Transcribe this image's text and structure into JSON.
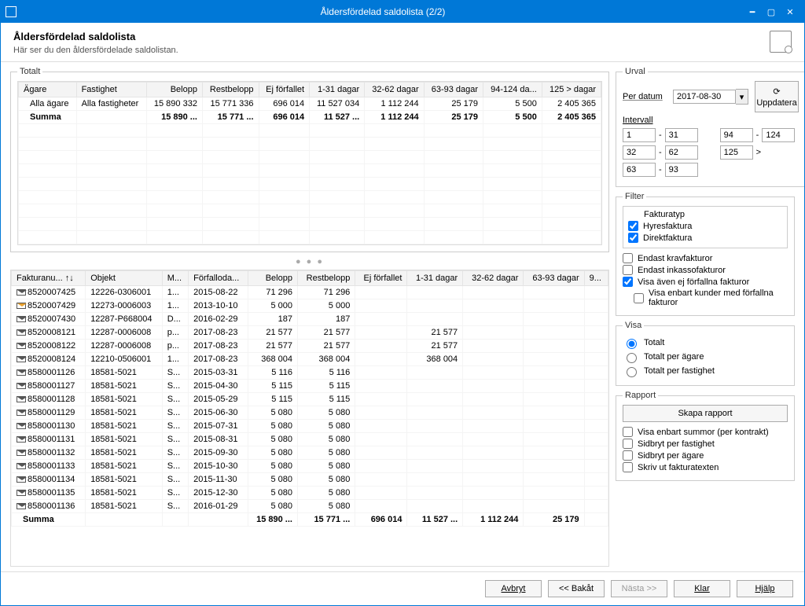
{
  "window": {
    "title": "Åldersfördelad saldolista (2/2)"
  },
  "header": {
    "title": "Åldersfördelad saldolista",
    "subtitle": "Här ser du den åldersfördelade saldolistan."
  },
  "topGrid": {
    "legend": "Totalt",
    "columns": [
      "Ägare",
      "Fastighet",
      "Belopp",
      "Restbelopp",
      "Ej förfallet",
      "1-31 dagar",
      "32-62 dagar",
      "63-93 dagar",
      "94-124 da...",
      "125 > dagar"
    ],
    "rows": [
      {
        "cells": [
          "Alla ägare",
          "Alla fastigheter",
          "15 890 332",
          "15 771 336",
          "696 014",
          "11 527 034",
          "1 112 244",
          "25 179",
          "5 500",
          "2 405 365"
        ],
        "indent": true
      },
      {
        "cells": [
          "Summa",
          "",
          "15 890 ...",
          "15 771 ...",
          "696 014",
          "11 527 ...",
          "1 112 244",
          "25 179",
          "5 500",
          "2 405 365"
        ],
        "bold": true,
        "indent": true
      }
    ]
  },
  "detailGrid": {
    "columns": [
      "Fakturanu...   ↑↓",
      "Objekt",
      "M...",
      "Förfalloda...",
      "Belopp",
      "Restbelopp",
      "Ej förfallet",
      "1-31 dagar",
      "32-62 dagar",
      "63-93 dagar",
      "9..."
    ],
    "rows": [
      {
        "fnr": "8520007425",
        "obj": "12226-0306001",
        "m": "1...",
        "fd": "2015-08-22",
        "bel": "71 296",
        "rest": "71 296",
        "ef": "",
        "d1": "",
        "d2": "",
        "d3": ""
      },
      {
        "fnr": "8520007429",
        "obj": "12273-0006003",
        "m": "1...",
        "fd": "2013-10-10",
        "bel": "5 000",
        "rest": "5 000",
        "ef": "",
        "d1": "",
        "d2": "",
        "d3": "",
        "orange": true
      },
      {
        "fnr": "8520007430",
        "obj": "12287-P668004",
        "m": "D...",
        "fd": "2016-02-29",
        "bel": "187",
        "rest": "187",
        "ef": "",
        "d1": "",
        "d2": "",
        "d3": ""
      },
      {
        "fnr": "8520008121",
        "obj": "12287-0006008",
        "m": "p...",
        "fd": "2017-08-23",
        "bel": "21 577",
        "rest": "21 577",
        "ef": "",
        "d1": "21 577",
        "d2": "",
        "d3": ""
      },
      {
        "fnr": "8520008122",
        "obj": "12287-0006008",
        "m": "p...",
        "fd": "2017-08-23",
        "bel": "21 577",
        "rest": "21 577",
        "ef": "",
        "d1": "21 577",
        "d2": "",
        "d3": ""
      },
      {
        "fnr": "8520008124",
        "obj": "12210-0506001",
        "m": "1...",
        "fd": "2017-08-23",
        "bel": "368 004",
        "rest": "368 004",
        "ef": "",
        "d1": "368 004",
        "d2": "",
        "d3": ""
      },
      {
        "fnr": "8580001126",
        "obj": "18581-5021",
        "m": "S...",
        "fd": "2015-03-31",
        "bel": "5 116",
        "rest": "5 116",
        "ef": "",
        "d1": "",
        "d2": "",
        "d3": ""
      },
      {
        "fnr": "8580001127",
        "obj": "18581-5021",
        "m": "S...",
        "fd": "2015-04-30",
        "bel": "5 115",
        "rest": "5 115",
        "ef": "",
        "d1": "",
        "d2": "",
        "d3": ""
      },
      {
        "fnr": "8580001128",
        "obj": "18581-5021",
        "m": "S...",
        "fd": "2015-05-29",
        "bel": "5 115",
        "rest": "5 115",
        "ef": "",
        "d1": "",
        "d2": "",
        "d3": ""
      },
      {
        "fnr": "8580001129",
        "obj": "18581-5021",
        "m": "S...",
        "fd": "2015-06-30",
        "bel": "5 080",
        "rest": "5 080",
        "ef": "",
        "d1": "",
        "d2": "",
        "d3": ""
      },
      {
        "fnr": "8580001130",
        "obj": "18581-5021",
        "m": "S...",
        "fd": "2015-07-31",
        "bel": "5 080",
        "rest": "5 080",
        "ef": "",
        "d1": "",
        "d2": "",
        "d3": ""
      },
      {
        "fnr": "8580001131",
        "obj": "18581-5021",
        "m": "S...",
        "fd": "2015-08-31",
        "bel": "5 080",
        "rest": "5 080",
        "ef": "",
        "d1": "",
        "d2": "",
        "d3": ""
      },
      {
        "fnr": "8580001132",
        "obj": "18581-5021",
        "m": "S...",
        "fd": "2015-09-30",
        "bel": "5 080",
        "rest": "5 080",
        "ef": "",
        "d1": "",
        "d2": "",
        "d3": ""
      },
      {
        "fnr": "8580001133",
        "obj": "18581-5021",
        "m": "S...",
        "fd": "2015-10-30",
        "bel": "5 080",
        "rest": "5 080",
        "ef": "",
        "d1": "",
        "d2": "",
        "d3": ""
      },
      {
        "fnr": "8580001134",
        "obj": "18581-5021",
        "m": "S...",
        "fd": "2015-11-30",
        "bel": "5 080",
        "rest": "5 080",
        "ef": "",
        "d1": "",
        "d2": "",
        "d3": ""
      },
      {
        "fnr": "8580001135",
        "obj": "18581-5021",
        "m": "S...",
        "fd": "2015-12-30",
        "bel": "5 080",
        "rest": "5 080",
        "ef": "",
        "d1": "",
        "d2": "",
        "d3": ""
      },
      {
        "fnr": "8580001136",
        "obj": "18581-5021",
        "m": "S...",
        "fd": "2016-01-29",
        "bel": "5 080",
        "rest": "5 080",
        "ef": "",
        "d1": "",
        "d2": "",
        "d3": ""
      }
    ],
    "sum": {
      "label": "Summa",
      "bel": "15 890 ...",
      "rest": "15 771 ...",
      "ef": "696 014",
      "d1": "11 527 ...",
      "d2": "1 112 244",
      "d3": "25 179"
    }
  },
  "urval": {
    "legend": "Urval",
    "perDatumLabel": "Per datum",
    "perDatum": "2017-08-30",
    "uppdatera": "Uppdatera",
    "intervallLabel": "Intervall",
    "r": [
      [
        "1",
        "31",
        "94",
        "124"
      ],
      [
        "32",
        "62",
        "125",
        ">"
      ],
      [
        "63",
        "93",
        "",
        ""
      ]
    ]
  },
  "filter": {
    "legend": "Filter",
    "typeHeader": "Fakturatyp",
    "types": [
      {
        "label": "Hyresfaktura",
        "checked": true
      },
      {
        "label": "Direktfaktura",
        "checked": true
      }
    ],
    "opts": [
      {
        "label": "Endast kravfakturor",
        "checked": false
      },
      {
        "label": "Endast inkassofakturor",
        "checked": false
      },
      {
        "label": "Visa även ej förfallna fakturor",
        "checked": true
      },
      {
        "label": "Visa enbart kunder med förfallna fakturor",
        "checked": false,
        "indent": true
      }
    ]
  },
  "visa": {
    "legend": "Visa",
    "opts": [
      {
        "label": "Totalt",
        "checked": true
      },
      {
        "label": "Totalt per ägare",
        "checked": false
      },
      {
        "label": "Totalt per fastighet",
        "checked": false
      }
    ]
  },
  "rapport": {
    "legend": "Rapport",
    "button": "Skapa rapport",
    "opts": [
      {
        "label": "Visa enbart summor (per kontrakt)"
      },
      {
        "label": "Sidbryt per fastighet"
      },
      {
        "label": "Sidbryt per ägare"
      },
      {
        "label": "Skriv ut fakturatexten"
      }
    ]
  },
  "footer": {
    "avbryt": "Avbryt",
    "bakat": "<< Bakåt",
    "nasta": "Nästa >>",
    "klar": "Klar",
    "hjalp": "Hjälp"
  }
}
